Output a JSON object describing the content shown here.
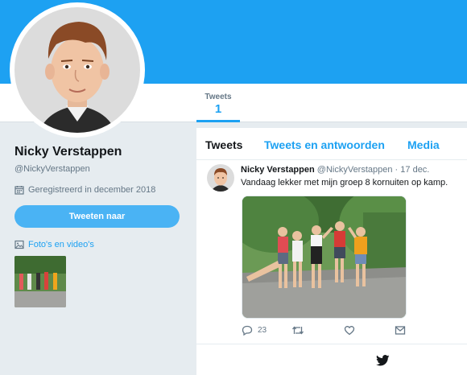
{
  "nav": {
    "tweets_label": "Tweets",
    "tweets_count": "1"
  },
  "profile": {
    "name": "Nicky Verstappen",
    "handle": "@NickyVerstappen",
    "joined": "Geregistreerd in december 2018",
    "tweet_button": "Tweeten naar",
    "media_link": "Foto's en video's"
  },
  "tabs": [
    "Tweets",
    "Tweets en antwoorden",
    "Media"
  ],
  "tweet": {
    "name": "Nicky Verstappen",
    "handle": "@NickyVerstappen",
    "separator": " · ",
    "date": "17 dec.",
    "text": "Vandaag lekker met mijn groep 8 kornuiten op kamp.",
    "reply_count": "23"
  },
  "icons": {
    "calendar": "calendar-icon",
    "media": "image-icon",
    "reply": "reply-icon",
    "retweet": "retweet-icon",
    "like": "heart-icon",
    "message": "envelope-icon",
    "brand": "twitter-bird-icon"
  },
  "colors": {
    "accent": "#1da1f2",
    "button": "#4ab3f4",
    "background": "#e6ecf0",
    "muted": "#657786"
  }
}
